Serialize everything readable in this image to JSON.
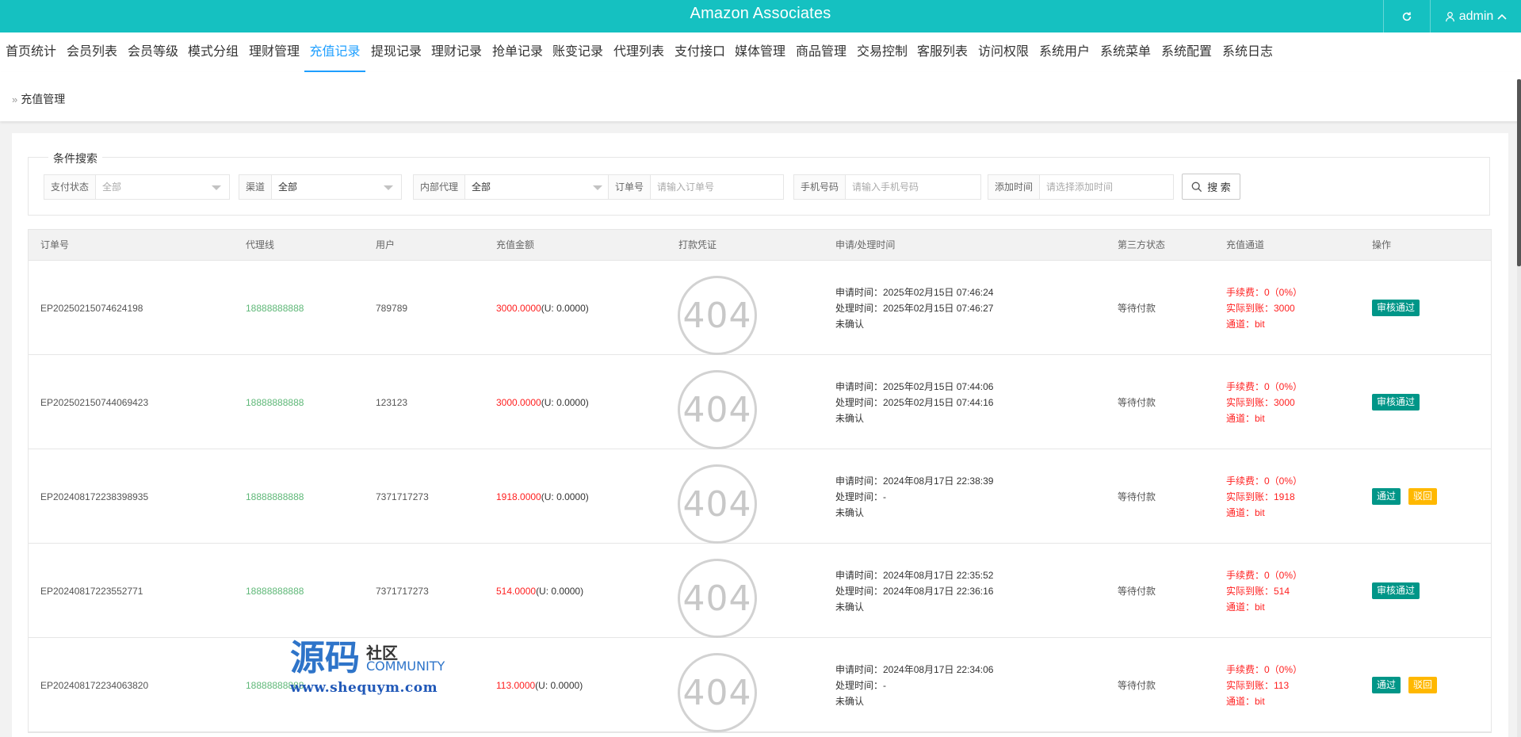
{
  "header": {
    "title": "Amazon Associates",
    "user": "admin",
    "bg_color": "#15c1c1"
  },
  "nav": {
    "items": [
      "首页统计",
      "会员列表",
      "会员等级",
      "模式分组",
      "理财管理",
      "充值记录",
      "提现记录",
      "理财记录",
      "抢单记录",
      "账变记录",
      "代理列表",
      "支付接口",
      "媒体管理",
      "商品管理",
      "交易控制",
      "客服列表",
      "访问权限",
      "系统用户",
      "系统菜单",
      "系统配置",
      "系统日志"
    ],
    "active": "充值记录",
    "active_color": "#1e9fff"
  },
  "breadcrumb": "充值管理",
  "search": {
    "legend": "条件搜索",
    "pay_status": {
      "label": "支付状态",
      "value": "全部"
    },
    "channel": {
      "label": "渠道",
      "value": "全部"
    },
    "agent": {
      "label": "内部代理",
      "value": "全部"
    },
    "order": {
      "label": "订单号",
      "placeholder": "请输入订单号"
    },
    "phone": {
      "label": "手机号码",
      "placeholder": "请输入手机号码"
    },
    "add_time": {
      "label": "添加时间",
      "placeholder": "请选择添加时间"
    },
    "button": "搜 索"
  },
  "table": {
    "headers": {
      "order": "订单号",
      "agent": "代理线",
      "user": "用户",
      "amount": "充值金额",
      "voucher": "打款凭证",
      "time": "申请/处理时间",
      "third": "第三方状态",
      "channel": "充值通道",
      "ops": "操作"
    },
    "rows": [
      {
        "order": "EP20250215074624198",
        "agent": "18888888888",
        "user": "789789",
        "amount": "3000.0000",
        "amount_u": "(U: 0.0000)",
        "voucher": "404",
        "apply": "申请时间：2025年02月15日 07:46:24",
        "process": "处理时间：2025年02月15日 07:46:27",
        "confirm": "未确认",
        "third": "等待付款",
        "fee": "手续费：0（0%）",
        "actual": "实际到账：3000",
        "channel": "通道：bit",
        "actions": [
          "审核通过"
        ]
      },
      {
        "order": "EP202502150744069423",
        "agent": "18888888888",
        "user": "123123",
        "amount": "3000.0000",
        "amount_u": "(U: 0.0000)",
        "voucher": "404",
        "apply": "申请时间：2025年02月15日 07:44:06",
        "process": "处理时间：2025年02月15日 07:44:16",
        "confirm": "未确认",
        "third": "等待付款",
        "fee": "手续费：0（0%）",
        "actual": "实际到账：3000",
        "channel": "通道：bit",
        "actions": [
          "审核通过"
        ]
      },
      {
        "order": "EP202408172238398935",
        "agent": "18888888888",
        "user": "7371717273",
        "amount": "1918.0000",
        "amount_u": "(U: 0.0000)",
        "voucher": "404",
        "apply": "申请时间：2024年08月17日 22:38:39",
        "process": "处理时间：-",
        "confirm": "未确认",
        "third": "等待付款",
        "fee": "手续费：0（0%）",
        "actual": "实际到账：1918",
        "channel": "通道：bit",
        "actions": [
          "通过",
          "驳回"
        ]
      },
      {
        "order": "EP20240817223552771",
        "agent": "18888888888",
        "user": "7371717273",
        "amount": "514.0000",
        "amount_u": "(U: 0.0000)",
        "voucher": "404",
        "apply": "申请时间：2024年08月17日 22:35:52",
        "process": "处理时间：2024年08月17日 22:36:16",
        "confirm": "未确认",
        "third": "等待付款",
        "fee": "手续费：0（0%）",
        "actual": "实际到账：514",
        "channel": "通道：bit",
        "actions": [
          "审核通过"
        ]
      },
      {
        "order": "EP202408172234063820",
        "agent": "18888888888",
        "user": "",
        "amount": "113.0000",
        "amount_u": "(U: 0.0000)",
        "voucher": "404",
        "apply": "申请时间：2024年08月17日 22:34:06",
        "process": "处理时间：-",
        "confirm": "未确认",
        "third": "等待付款",
        "fee": "手续费：0（0%）",
        "actual": "实际到账：113",
        "channel": "通道：bit",
        "actions": [
          "通过",
          "驳回"
        ]
      }
    ]
  },
  "watermark": {
    "big": "源码",
    "she": "社区",
    "community": "COMMUNITY",
    "url": "www.shequym.com"
  }
}
